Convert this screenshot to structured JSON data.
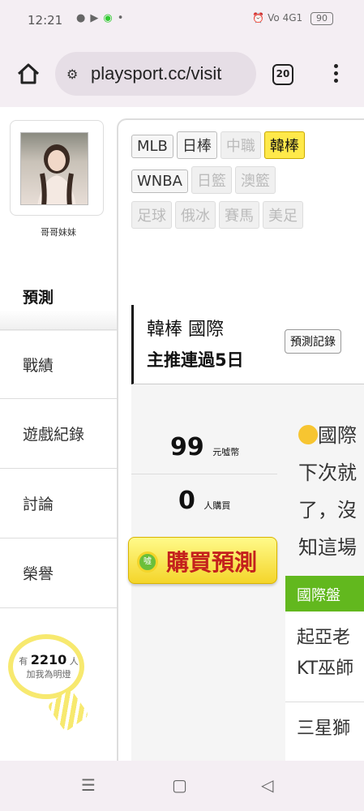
{
  "status_bar": {
    "time": "12:21",
    "left_icons": [
      "chat-icon",
      "youtube-icon",
      "whatsapp-icon",
      "dot-icon"
    ],
    "right_icons": [
      "alarm-icon",
      "volte-icon",
      "signal-icon"
    ],
    "signal_text": "4G1",
    "battery": "90"
  },
  "browser": {
    "url": "playsport.cc/visit",
    "tab_count": "20"
  },
  "sidebar": {
    "user_name": "哥哥妹妹",
    "items": [
      {
        "label": "預測",
        "active": true
      },
      {
        "label": "戰績",
        "active": false
      },
      {
        "label": "遊戲紀錄",
        "active": false
      },
      {
        "label": "討論",
        "active": false
      },
      {
        "label": "榮譽",
        "active": false
      }
    ],
    "fans_prefix": "有",
    "fans_count": "2210",
    "fans_unit": "人",
    "fans_label": "加我為明燈"
  },
  "leagues": {
    "row1": [
      {
        "label": "MLB",
        "state": "normal"
      },
      {
        "label": "日棒",
        "state": "normal"
      },
      {
        "label": "中職",
        "state": "muted"
      },
      {
        "label": "韓棒",
        "state": "active"
      }
    ],
    "row2": [
      {
        "label": "WNBA",
        "state": "normal"
      },
      {
        "label": "日籃",
        "state": "muted"
      },
      {
        "label": "澳籃",
        "state": "muted"
      }
    ],
    "row3": [
      {
        "label": "足球",
        "state": "muted"
      },
      {
        "label": "俄冰",
        "state": "muted"
      },
      {
        "label": "賽馬",
        "state": "muted"
      },
      {
        "label": "美足",
        "state": "muted"
      }
    ]
  },
  "prediction": {
    "title": "韓棒 國際",
    "subtitle": "主推連過5日",
    "record_button": "預測記錄",
    "price": "99",
    "price_unit": "元噓幣",
    "buyers": "0",
    "buyers_unit": "人購買",
    "buy_button": "購買預測",
    "coin_label": "噓",
    "description_lines": [
      "國際",
      "下次就",
      "了，沒",
      "知這場"
    ],
    "market_label": "國際盤",
    "games": [
      {
        "line1": "起亞老",
        "line2": "KT巫師"
      },
      {
        "line1": "三星獅",
        "line2": ""
      }
    ]
  },
  "colors": {
    "active_tag": "#ffe94a",
    "buy_text": "#c4211d",
    "market_green": "#62b81e",
    "bulb_yellow": "#f7e96f"
  }
}
